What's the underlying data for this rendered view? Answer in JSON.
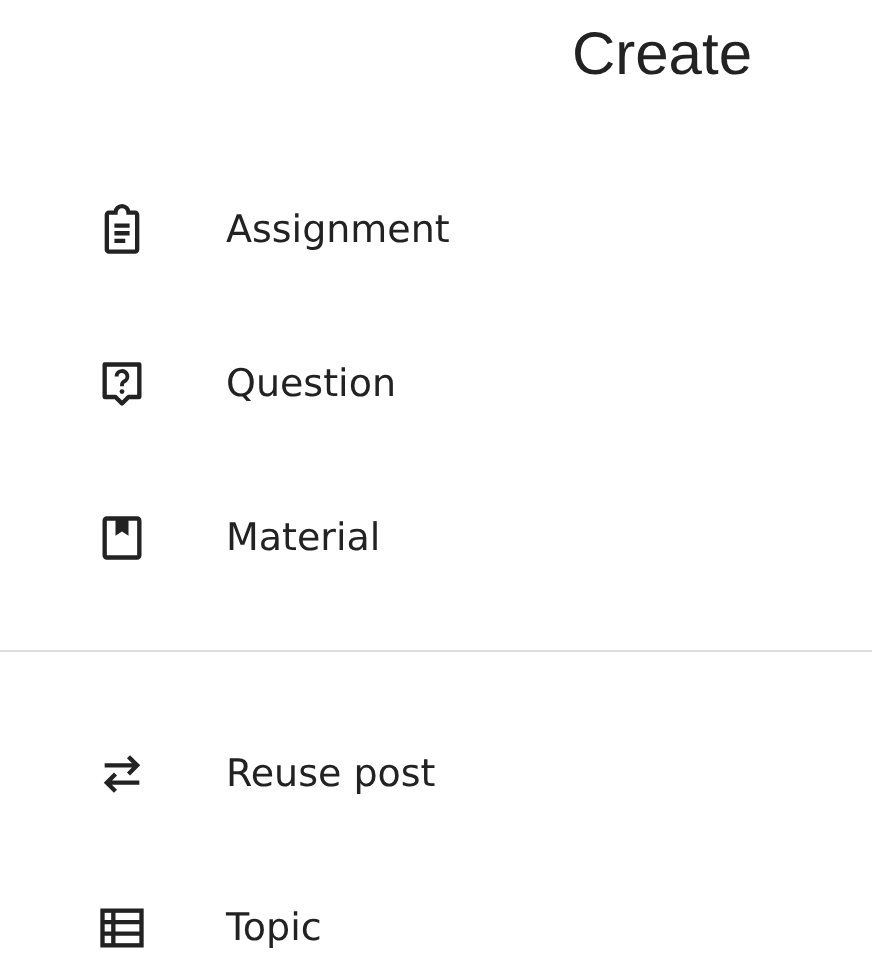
{
  "title": "Create",
  "sections": [
    {
      "items": [
        {
          "label": "Assignment",
          "kind": "assignment"
        },
        {
          "label": "Question",
          "kind": "question"
        },
        {
          "label": "Material",
          "kind": "material"
        }
      ]
    },
    {
      "items": [
        {
          "label": "Reuse post",
          "kind": "reuse"
        },
        {
          "label": "Topic",
          "kind": "topic"
        }
      ]
    }
  ]
}
